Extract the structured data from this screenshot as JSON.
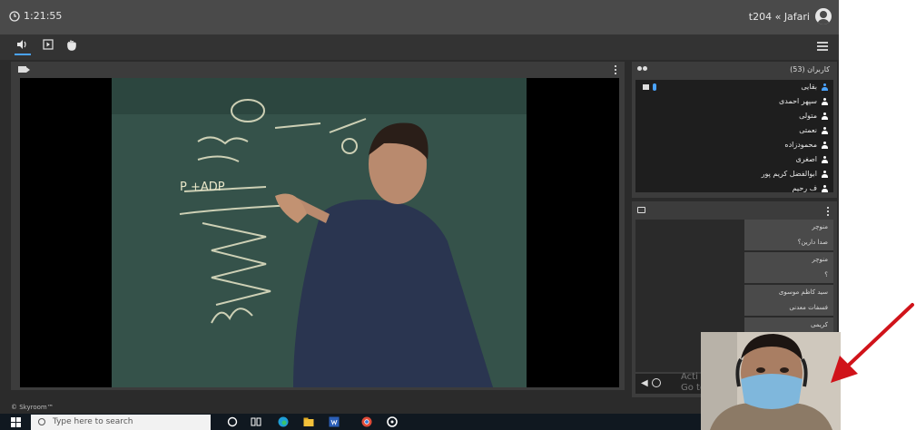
{
  "topbar": {
    "timer": "1:21:55",
    "user_label": "t204 « Jafari"
  },
  "toolbar": {
    "items": [
      "speaker-icon",
      "play-icon",
      "raise-hand-icon"
    ]
  },
  "users_panel": {
    "title": "کاربران (53)",
    "users": [
      "بقایی",
      "سپهر احمدی",
      "متولی",
      "نعمتی",
      "محمودزاده",
      "اصغری",
      "ابوالفضل کریم پور",
      "ف رحیم"
    ]
  },
  "chat_panel": {
    "messages": [
      {
        "name": "منوچر",
        "text": "صدا دارین؟"
      },
      {
        "name": "منوچر",
        "text": "؟"
      },
      {
        "name": "سید کاظم موسوی",
        "text": "فسفات معدنی"
      },
      {
        "name": "کریمی",
        "text": ""
      }
    ],
    "watermark_line1": "Acti",
    "watermark_line2": "Go to"
  },
  "footer": {
    "brand": "© Skyroom™"
  },
  "taskbar": {
    "search_placeholder": "Type here to search"
  },
  "colors": {
    "accent": "#4aa3ff",
    "arrow": "#d0131a"
  }
}
